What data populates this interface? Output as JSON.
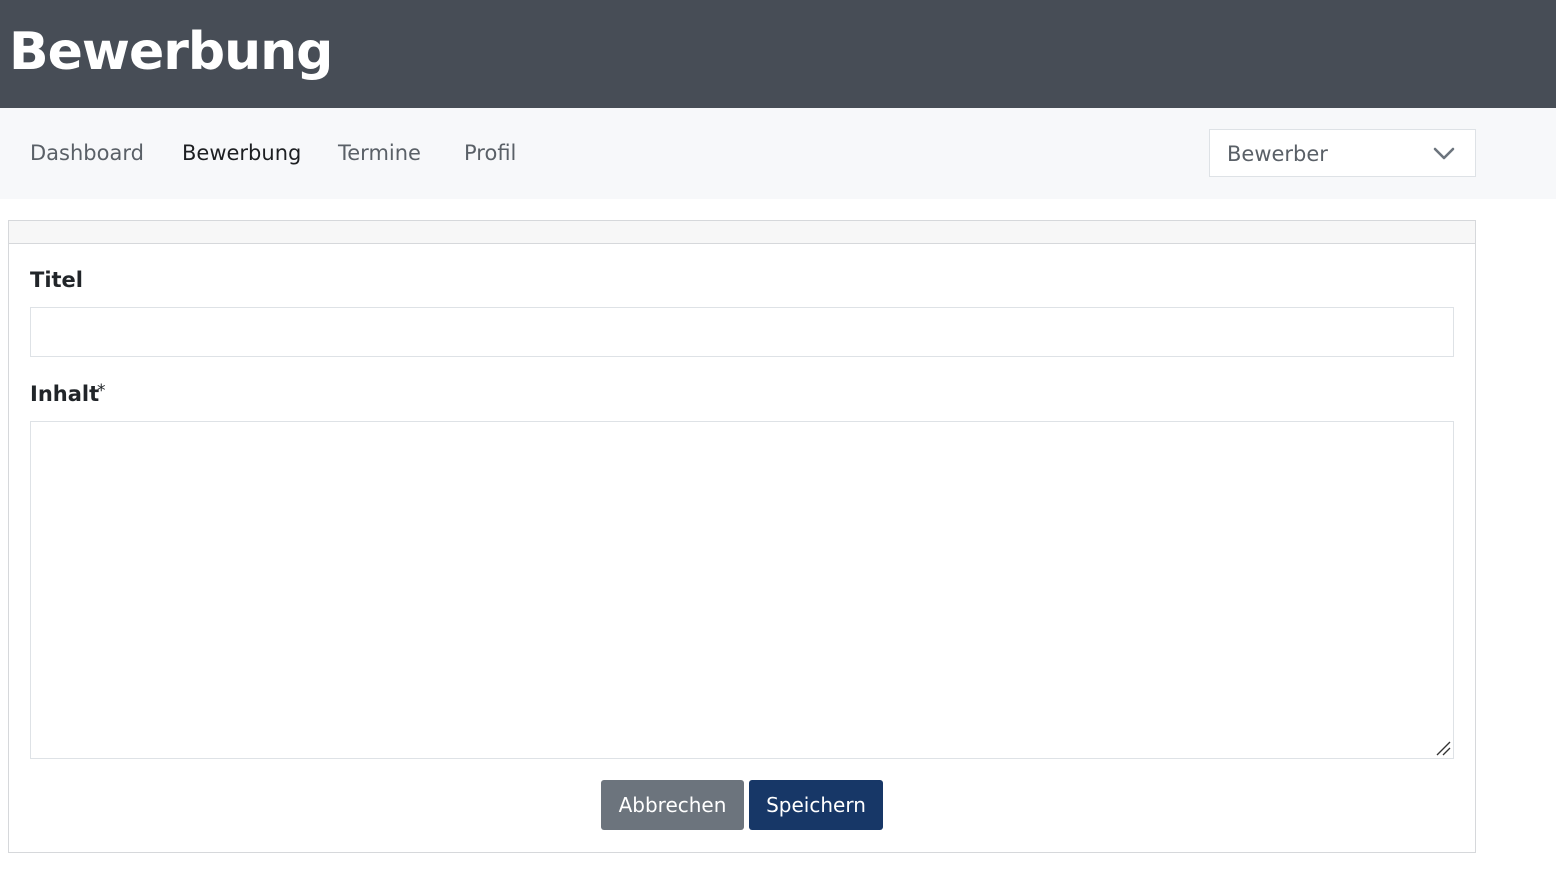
{
  "header": {
    "title": "Bewerbung"
  },
  "nav": {
    "items": [
      {
        "label": "Dashboard",
        "active": false
      },
      {
        "label": "Bewerbung",
        "active": true
      },
      {
        "label": "Termine",
        "active": false
      },
      {
        "label": "Profil",
        "active": false
      }
    ],
    "role_select": {
      "value": "Bewerber",
      "icon": "chevron-down-icon"
    }
  },
  "form": {
    "title_field": {
      "label": "Titel",
      "value": "",
      "placeholder": ""
    },
    "content_field": {
      "label": "Inhalt",
      "required_marker": "*",
      "value": "",
      "placeholder": ""
    },
    "buttons": {
      "cancel_label": "Abbrechen",
      "save_label": "Speichern"
    }
  },
  "colors": {
    "header_bg": "#474d56",
    "nav_bg": "#f7f8fa",
    "cancel_button": "#6c747d",
    "save_button": "#173767"
  }
}
